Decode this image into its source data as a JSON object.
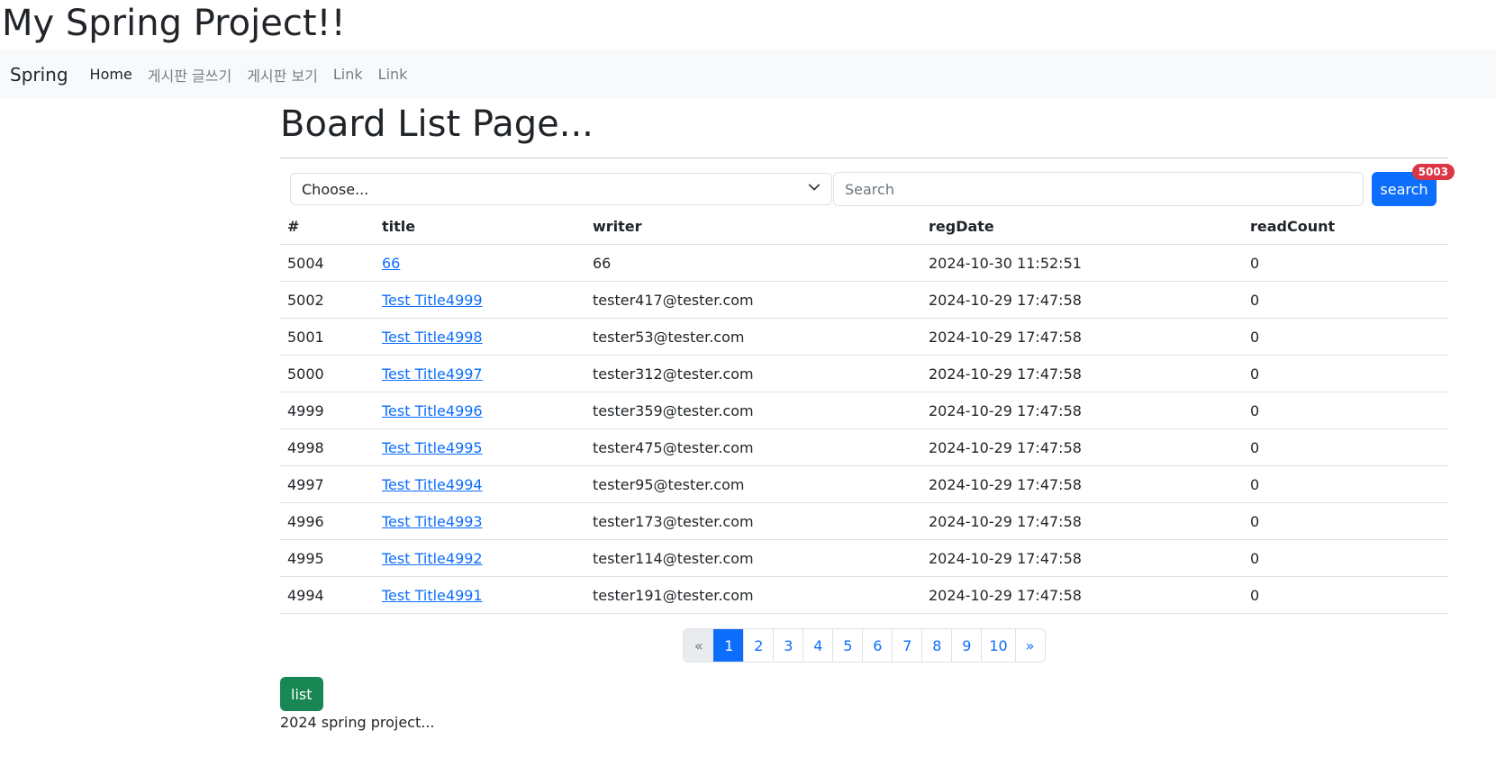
{
  "site": {
    "title": "My Spring Project!!"
  },
  "nav": {
    "brand": "Spring",
    "links": [
      {
        "label": "Home"
      },
      {
        "label": "게시판 글쓰기"
      },
      {
        "label": "게시판 보기"
      },
      {
        "label": "Link"
      },
      {
        "label": "Link"
      }
    ]
  },
  "page": {
    "title": "Board List Page..."
  },
  "search": {
    "select_value": "Choose...",
    "input_placeholder": "Search",
    "button_label": "search",
    "badge_count": "5003",
    "chevron_icon": "chevron-down-icon"
  },
  "table": {
    "headers": [
      "#",
      "title",
      "writer",
      "regDate",
      "readCount"
    ],
    "rows": [
      {
        "no": "5004",
        "title": "66",
        "writer": "66",
        "regDate": "2024-10-30 11:52:51",
        "readCount": "0"
      },
      {
        "no": "5002",
        "title": "Test Title4999",
        "writer": "tester417@tester.com",
        "regDate": "2024-10-29 17:47:58",
        "readCount": "0"
      },
      {
        "no": "5001",
        "title": "Test Title4998",
        "writer": "tester53@tester.com",
        "regDate": "2024-10-29 17:47:58",
        "readCount": "0"
      },
      {
        "no": "5000",
        "title": "Test Title4997",
        "writer": "tester312@tester.com",
        "regDate": "2024-10-29 17:47:58",
        "readCount": "0"
      },
      {
        "no": "4999",
        "title": "Test Title4996",
        "writer": "tester359@tester.com",
        "regDate": "2024-10-29 17:47:58",
        "readCount": "0"
      },
      {
        "no": "4998",
        "title": "Test Title4995",
        "writer": "tester475@tester.com",
        "regDate": "2024-10-29 17:47:58",
        "readCount": "0"
      },
      {
        "no": "4997",
        "title": "Test Title4994",
        "writer": "tester95@tester.com",
        "regDate": "2024-10-29 17:47:58",
        "readCount": "0"
      },
      {
        "no": "4996",
        "title": "Test Title4993",
        "writer": "tester173@tester.com",
        "regDate": "2024-10-29 17:47:58",
        "readCount": "0"
      },
      {
        "no": "4995",
        "title": "Test Title4992",
        "writer": "tester114@tester.com",
        "regDate": "2024-10-29 17:47:58",
        "readCount": "0"
      },
      {
        "no": "4994",
        "title": "Test Title4991",
        "writer": "tester191@tester.com",
        "regDate": "2024-10-29 17:47:58",
        "readCount": "0"
      }
    ]
  },
  "pagination": {
    "prev": "«",
    "pages": [
      "1",
      "2",
      "3",
      "4",
      "5",
      "6",
      "7",
      "8",
      "9",
      "10"
    ],
    "active": "1",
    "next": "»"
  },
  "list_button": "list",
  "footer": {
    "text": "2024 spring project..."
  },
  "colors": {
    "primary": "#0d6efd",
    "success": "#198754",
    "danger": "#dc3545",
    "navbar_bg": "#f8f9fa"
  }
}
